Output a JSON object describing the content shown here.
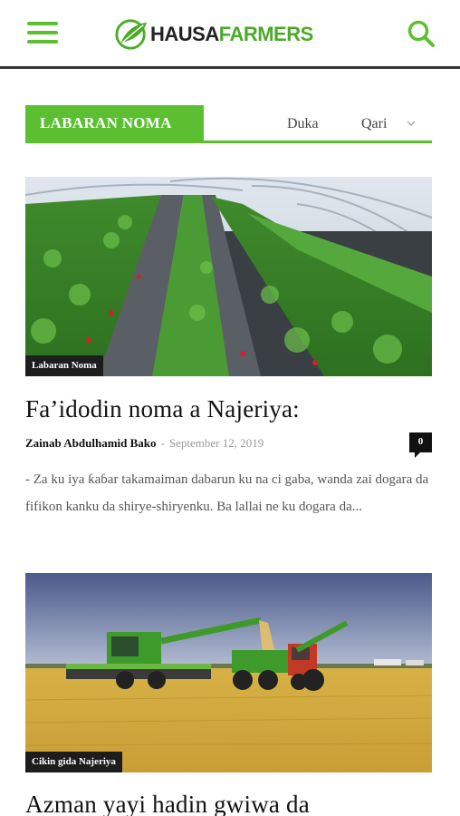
{
  "header": {
    "logo_text_part1": "HAUSA",
    "logo_text_part2": "FARMERS"
  },
  "section": {
    "title": "LABARAN NOMA",
    "tabs": [
      {
        "label": "Duka"
      },
      {
        "label": "Qari"
      }
    ]
  },
  "articles": [
    {
      "category": "Labaran Noma",
      "title": "Fa’idodin noma a Najeriya:",
      "author": "Zainab Abdulhamid Bako",
      "separator": "-",
      "date": "September 12, 2019",
      "comments": "0",
      "excerpt": " - Za ku iya ƙaɓar takamaiman dabarun ku na ci gaba, wanda zai dogara da fifikon kanku da shirye-shiryenku.  Ba lallai ne ku dogara da..."
    },
    {
      "category": "Cikin gida Najeriya",
      "title": "Azman yayi hadin gwiwa da"
    }
  ],
  "icons": {
    "menu": "hamburger-menu-icon",
    "search": "search-icon",
    "dropdown": "chevron-down-icon",
    "comment": "comment-bubble-icon"
  },
  "colors": {
    "brand_green": "#5cbf32",
    "badge_dark": "#1d1d1d",
    "meta_gray": "#999999"
  }
}
